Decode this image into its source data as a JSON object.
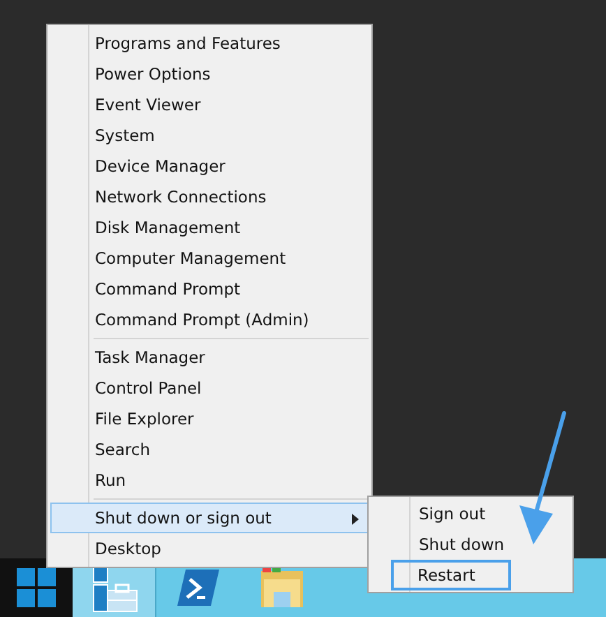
{
  "menu": {
    "groups": [
      [
        {
          "label": "Programs and Features",
          "selected": false
        },
        {
          "label": "Power Options",
          "selected": false
        },
        {
          "label": "Event Viewer",
          "selected": false
        },
        {
          "label": "System",
          "selected": false
        },
        {
          "label": "Device Manager",
          "selected": false
        },
        {
          "label": "Network Connections",
          "selected": false
        },
        {
          "label": "Disk Management",
          "selected": false
        },
        {
          "label": "Computer Management",
          "selected": false
        },
        {
          "label": "Command Prompt",
          "selected": false
        },
        {
          "label": "Command Prompt (Admin)",
          "selected": false
        }
      ],
      [
        {
          "label": "Task Manager",
          "selected": false
        },
        {
          "label": "Control Panel",
          "selected": false
        },
        {
          "label": "File Explorer",
          "selected": false
        },
        {
          "label": "Search",
          "selected": false
        },
        {
          "label": "Run",
          "selected": false
        }
      ],
      [
        {
          "label": "Shut down or sign out",
          "selected": true,
          "submenu": {
            "items": [
              {
                "label": "Sign out",
                "selected": false,
                "annotated": false
              },
              {
                "label": "Shut down",
                "selected": false,
                "annotated": false
              },
              {
                "label": "Restart",
                "selected": false,
                "annotated": true
              }
            ]
          }
        },
        {
          "label": "Desktop",
          "selected": false
        }
      ]
    ]
  },
  "taskbar": {
    "apps": [
      {
        "kind": "server-manager",
        "selected": true
      },
      {
        "kind": "powershell",
        "selected": false
      },
      {
        "kind": "file-explorer",
        "selected": false
      }
    ]
  }
}
